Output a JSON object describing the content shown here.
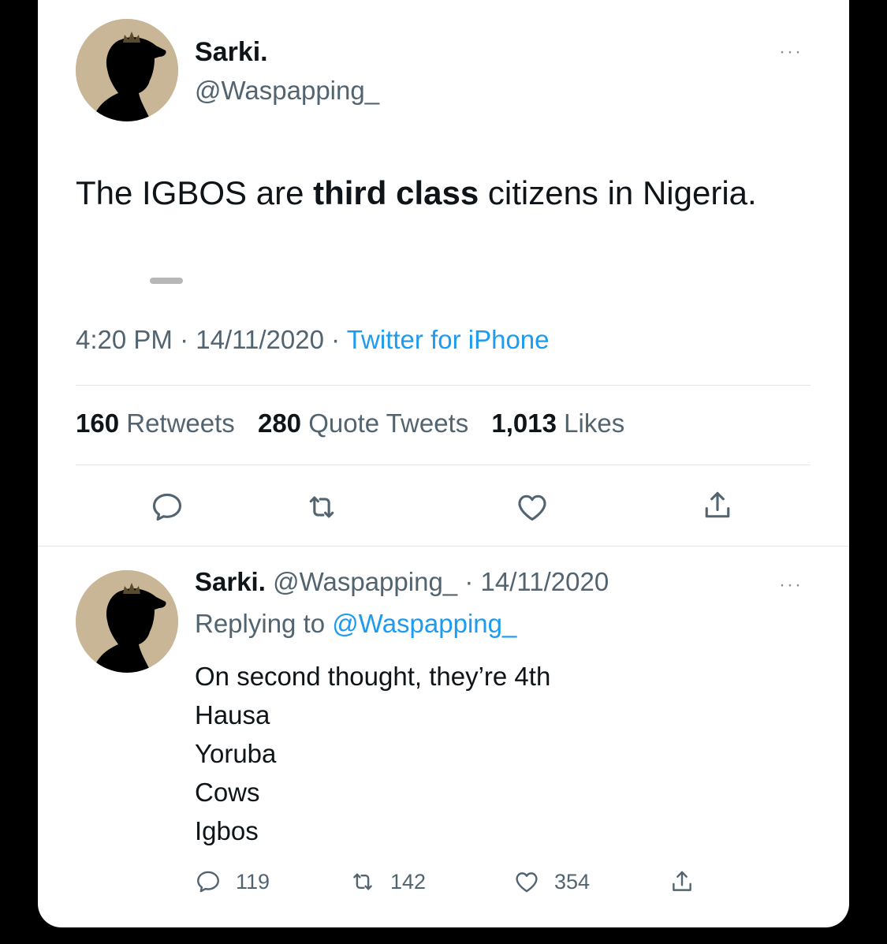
{
  "main_tweet": {
    "display_name": "Sarki.",
    "handle": "@Waspapping_",
    "more_label": "···",
    "text_parts": [
      "The IGBOS are ",
      "third class",
      " citizens in Nigeria."
    ],
    "time": "4:20 PM",
    "date": "14/11/2020",
    "separator": "·",
    "source": "Twitter for iPhone",
    "stats": {
      "retweets_count": "160",
      "retweets_label": "Retweets",
      "quotes_count": "280",
      "quotes_label": "Quote Tweets",
      "likes_count": "1,013",
      "likes_label": "Likes"
    },
    "actions": [
      "reply-icon",
      "retweet-icon",
      "like-icon",
      "share-icon"
    ]
  },
  "reply_tweet": {
    "display_name": "Sarki.",
    "handle": "@Waspapping_",
    "date": "· 14/11/2020",
    "replying_prefix": "Replying to",
    "replying_to": "@Waspapping_",
    "more_label": "···",
    "lines": [
      "On second thought, they’re 4th",
      "Hausa",
      "Yoruba",
      "Cows",
      "Igbos"
    ],
    "reply_count": "119",
    "retweet_count": "142",
    "like_count": "354"
  },
  "colors": {
    "background": "#000000",
    "card": "#ffffff",
    "text": "#0f1419",
    "secondary_text": "#536471",
    "link": "#1d9bf0",
    "avatar_bg": "#c9b697"
  }
}
